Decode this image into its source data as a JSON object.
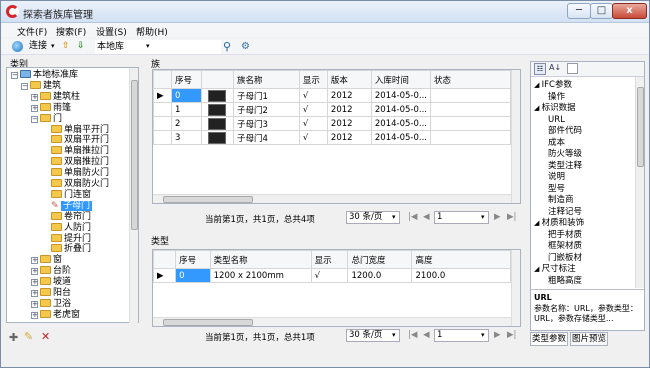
{
  "window": {
    "title": "探索者族库管理"
  },
  "window_controls": {
    "min": "─",
    "max": "□",
    "close": "x"
  },
  "menu": [
    "文件(F)",
    "搜索(F)",
    "设置(S)",
    "帮助(H)"
  ],
  "toolbar": {
    "connect": "连接",
    "library": "本地库"
  },
  "left": {
    "header": "类别",
    "tree": [
      {
        "label": "本地标准库",
        "indent": 0,
        "exp": "−"
      },
      {
        "label": "建筑",
        "indent": 1,
        "exp": "−"
      },
      {
        "label": "建筑柱",
        "indent": 2,
        "exp": "+"
      },
      {
        "label": "雨篷",
        "indent": 2,
        "exp": "+"
      },
      {
        "label": "门",
        "indent": 2,
        "exp": "−"
      },
      {
        "label": "单扇平开门",
        "indent": 3,
        "exp": ""
      },
      {
        "label": "双扇平开门",
        "indent": 3,
        "exp": ""
      },
      {
        "label": "单扇推拉门",
        "indent": 3,
        "exp": ""
      },
      {
        "label": "双扇推拉门",
        "indent": 3,
        "exp": ""
      },
      {
        "label": "单扇防火门",
        "indent": 3,
        "exp": ""
      },
      {
        "label": "双扇防火门",
        "indent": 3,
        "exp": ""
      },
      {
        "label": "门连窗",
        "indent": 3,
        "exp": ""
      },
      {
        "label": "子母门",
        "indent": 3,
        "exp": "",
        "selected": true
      },
      {
        "label": "卷帘门",
        "indent": 3,
        "exp": ""
      },
      {
        "label": "人防门",
        "indent": 3,
        "exp": ""
      },
      {
        "label": "提升门",
        "indent": 3,
        "exp": ""
      },
      {
        "label": "折叠门",
        "indent": 3,
        "exp": ""
      },
      {
        "label": "窗",
        "indent": 2,
        "exp": "+"
      },
      {
        "label": "台阶",
        "indent": 2,
        "exp": "+"
      },
      {
        "label": "坡道",
        "indent": 2,
        "exp": "+"
      },
      {
        "label": "阳台",
        "indent": 2,
        "exp": "+"
      },
      {
        "label": "卫浴",
        "indent": 2,
        "exp": "+"
      },
      {
        "label": "老虎窗",
        "indent": 2,
        "exp": "+"
      }
    ]
  },
  "family": {
    "header": "族",
    "columns": [
      "序号",
      "",
      "族名称",
      "显示",
      "版本",
      "入库时间",
      "状态"
    ],
    "rows": [
      {
        "no": "0",
        "name": "子母门1",
        "show": "√",
        "ver": "2012",
        "time": "2014-05-0..."
      },
      {
        "no": "1",
        "name": "子母门2",
        "show": "√",
        "ver": "2012",
        "time": "2014-05-0..."
      },
      {
        "no": "2",
        "name": "子母门3",
        "show": "√",
        "ver": "2012",
        "time": "2014-05-0..."
      },
      {
        "no": "3",
        "name": "子母门4",
        "show": "√",
        "ver": "2012",
        "time": "2014-05-0..."
      }
    ],
    "pager": {
      "summary": "当前第1页，共1页，总共4项",
      "per_page": "30 条/页",
      "page": "1"
    }
  },
  "type": {
    "header": "类型",
    "columns": [
      "序号",
      "类型名称",
      "显示",
      "总门宽度",
      "高度"
    ],
    "rows": [
      {
        "no": "0",
        "name": "1200 x 2100mm",
        "show": "√",
        "width": "1200.0",
        "height": "2100.0"
      }
    ],
    "pager": {
      "summary": "当前第1页，共1页，总共1项",
      "per_page": "30 条/页",
      "page": "1"
    }
  },
  "props": {
    "items": [
      {
        "t": "cat",
        "label": "IFC参数"
      },
      {
        "t": "row",
        "label": "操作"
      },
      {
        "t": "cat",
        "label": "标识数据"
      },
      {
        "t": "row",
        "label": "URL"
      },
      {
        "t": "row",
        "label": "部件代码"
      },
      {
        "t": "row",
        "label": "成本"
      },
      {
        "t": "row",
        "label": "防火等级"
      },
      {
        "t": "row",
        "label": "类型注释"
      },
      {
        "t": "row",
        "label": "说明"
      },
      {
        "t": "row",
        "label": "型号"
      },
      {
        "t": "row",
        "label": "制造商"
      },
      {
        "t": "row",
        "label": "注释记号"
      },
      {
        "t": "cat",
        "label": "材质和装饰"
      },
      {
        "t": "row",
        "label": "把手材质"
      },
      {
        "t": "row",
        "label": "框架材质"
      },
      {
        "t": "row",
        "label": "门嵌板材"
      },
      {
        "t": "cat",
        "label": "尺寸标注"
      },
      {
        "t": "row",
        "label": "粗略高度"
      }
    ],
    "desc_title": "URL",
    "desc_text": "参数名称：URL，参数类型：URL，参数存储类型..."
  },
  "tabs": [
    "类型参数",
    "图片预览"
  ]
}
